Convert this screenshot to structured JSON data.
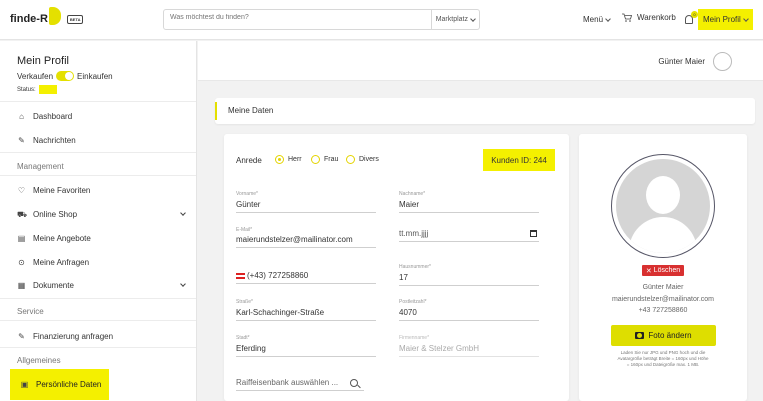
{
  "header": {
    "logo": "finde-R",
    "beta": "BETA",
    "search_placeholder": "Was möchtest du finden?",
    "search_category": "Marktplatz",
    "menu_label": "Menü",
    "cart_label": "Warenkorb",
    "notification_count": "0",
    "profile_label": "Mein Profil",
    "accent_color": "#f4f000"
  },
  "sidebar": {
    "title": "Mein Profil",
    "toggle_left": "Verkaufen",
    "toggle_right": "Einkaufen",
    "status_label": "Status:",
    "items": [
      {
        "label": "Dashboard",
        "icon": "home-icon"
      },
      {
        "label": "Nachrichten",
        "icon": "pencil-icon"
      }
    ],
    "section_management": "Management",
    "management_items": [
      {
        "label": "Meine Favoriten",
        "icon": "heart-icon"
      },
      {
        "label": "Online Shop",
        "icon": "cart-icon"
      },
      {
        "label": "Meine Angebote",
        "icon": "clipboard-icon"
      },
      {
        "label": "Meine Anfragen",
        "icon": "question-icon"
      },
      {
        "label": "Dokumente",
        "icon": "document-icon"
      }
    ],
    "section_service": "Service",
    "service_items": [
      {
        "label": "Finanzierung anfragen",
        "icon": "pencil-icon"
      }
    ],
    "section_general": "Allgemeines",
    "active_item": "Persönliche Daten"
  },
  "userbar": {
    "name": "Günter Maier"
  },
  "main": {
    "section_title": "Meine Daten",
    "anrede_label": "Anrede",
    "anrede_options": [
      "Herr",
      "Frau",
      "Divers"
    ],
    "anrede_selected": "Herr",
    "kunden_id": "Kunden ID: 244",
    "fields": {
      "vorname_label": "Vorname*",
      "vorname": "Günter",
      "nachname_label": "Nachname*",
      "nachname": "Maier",
      "email_label": "E-Mail*",
      "email": "maierundstelzer@mailinator.com",
      "date_placeholder": "tt.mm.jjjj",
      "phone_prefix": "(+43)",
      "phone": "727258860",
      "hausnummer_label": "Hausnummer*",
      "hausnummer": "17",
      "strasse_label": "Straße*",
      "strasse": "Karl-Schachinger-Straße",
      "postleitzahl_label": "Postleitzahl*",
      "postleitzahl": "4070",
      "stadt_label": "Stadt*",
      "stadt": "Eferding",
      "firmenname_label": "Firmenname*",
      "firmenname": "Maier & Stelzer GmbH",
      "bank_placeholder": "Raiffeisenbank auswählen ..."
    }
  },
  "profile_card": {
    "delete_label": "Löschen",
    "name": "Günter Maier",
    "email": "maierundstelzer@mailinator.com",
    "phone": "+43 727258860",
    "photo_button": "Foto ändern",
    "hint": "Laden Sie nur JPG und PNG hoch und die Avatargröße beträgt Breite = 160px und Höhe = 160px und Dateigröße max. 1 MB."
  }
}
